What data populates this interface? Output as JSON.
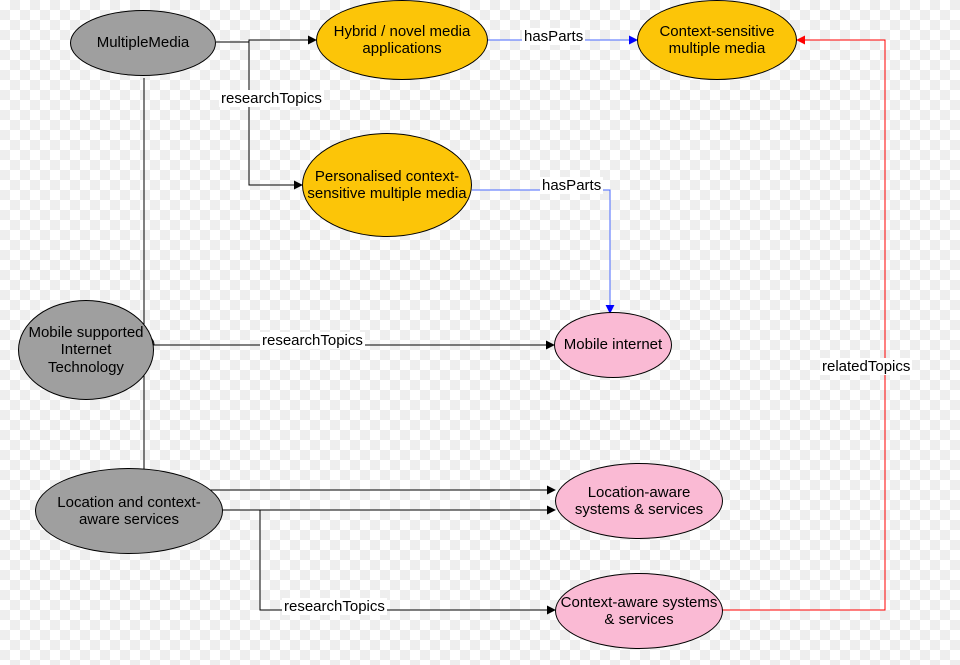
{
  "nodes": {
    "multipleMedia": "MultipleMedia",
    "hybridNovel": "Hybrid / novel media applications",
    "contextSensitive": "Context-sensitive multiple media",
    "personalised": "Personalised context-sensitive multiple media",
    "mobileSupported": "Mobile supported Internet Technology",
    "mobileInternet": "Mobile internet",
    "locationContextAware": "Location and context-aware services",
    "locationAwareSys": "Location-aware systems & services",
    "contextAwareSys": "Context-aware systems & services"
  },
  "edges": {
    "researchTopics1": "researchTopics",
    "researchTopics2": "researchTopics",
    "researchTopics3": "researchTopics",
    "hasParts1": "hasParts",
    "hasParts2": "hasParts",
    "relatedTopics": "relatedTopics"
  }
}
